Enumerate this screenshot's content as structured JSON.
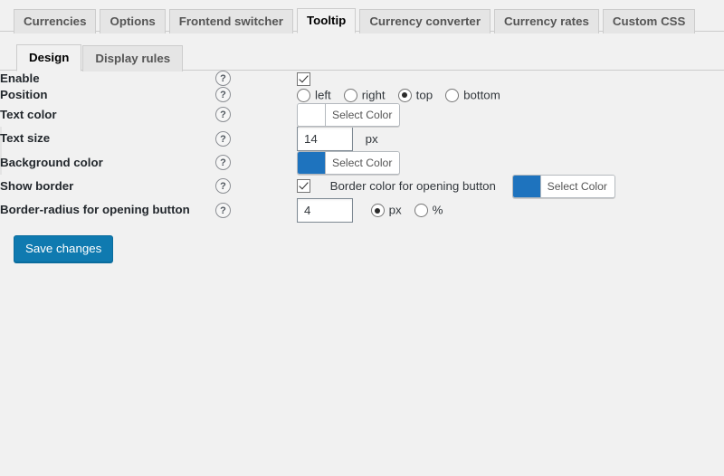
{
  "main_tabs": [
    {
      "label": "Currencies",
      "active": false
    },
    {
      "label": "Options",
      "active": false
    },
    {
      "label": "Frontend switcher",
      "active": false
    },
    {
      "label": "Tooltip",
      "active": true
    },
    {
      "label": "Currency converter",
      "active": false
    },
    {
      "label": "Currency rates",
      "active": false
    },
    {
      "label": "Custom CSS",
      "active": false
    }
  ],
  "sub_tabs": [
    {
      "label": "Design",
      "active": true
    },
    {
      "label": "Display rules",
      "active": false
    }
  ],
  "help_icon": "?",
  "rows": {
    "enable": {
      "label": "Enable",
      "checkbox_checked": true
    },
    "position": {
      "label": "Position",
      "options": [
        {
          "label": "left",
          "selected": false
        },
        {
          "label": "right",
          "selected": false
        },
        {
          "label": "top",
          "selected": true
        },
        {
          "label": "bottom",
          "selected": false
        }
      ]
    },
    "text_color": {
      "label": "Text color",
      "button_label": "Select Color",
      "swatch": "#ffffff"
    },
    "text_size": {
      "label": "Text size",
      "value": "14",
      "unit": "px"
    },
    "background_color": {
      "label": "Background color",
      "button_label": "Select Color",
      "swatch": "#1e73be"
    },
    "show_border": {
      "label": "Show border",
      "checkbox_checked": true,
      "border_color_label": "Border color for opening button",
      "button_label": "Select Color",
      "swatch": "#1e73be"
    },
    "border_radius": {
      "label": "Border-radius for opening button",
      "value": "4",
      "options": [
        {
          "label": "px",
          "selected": true
        },
        {
          "label": "%",
          "selected": false
        }
      ]
    }
  },
  "submit": {
    "label": "Save changes",
    "color": "#0f7ab0"
  }
}
